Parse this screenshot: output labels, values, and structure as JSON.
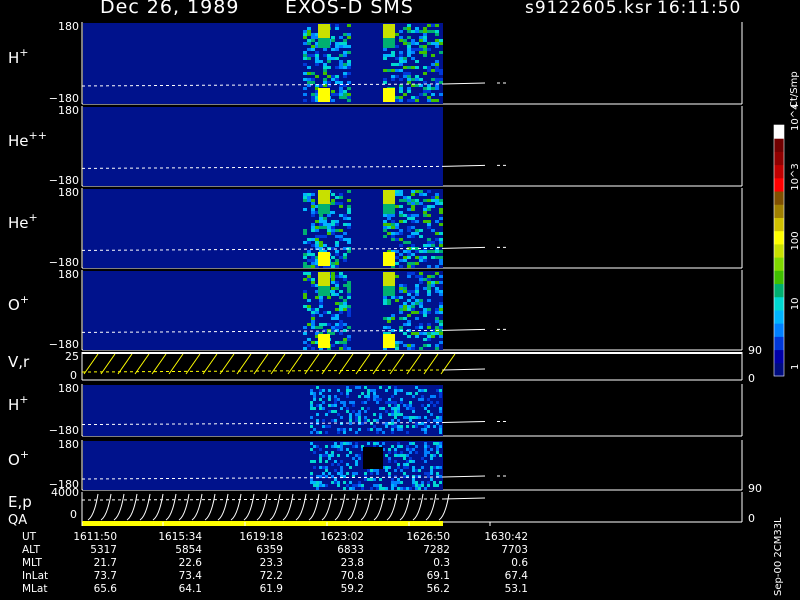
{
  "header": {
    "date": "Dec 26, 1989",
    "mission": "EXOS-D SMS",
    "file": "s9122605.ksr",
    "time": "16:11:50"
  },
  "colorbar": {
    "unit_label": "Ct/Smp",
    "ticks": [
      "1",
      "10",
      "100",
      "10^3",
      "10^4"
    ],
    "colors": [
      "#000c80",
      "#0000a8",
      "#0038d8",
      "#0080ff",
      "#00b4ff",
      "#00d8d0",
      "#00b070",
      "#40c000",
      "#80d800",
      "#c8e000",
      "#ffff00",
      "#d0c000",
      "#a08000",
      "#805000",
      "#ff0000",
      "#c00000",
      "#900000",
      "#700000",
      "#ffffff"
    ]
  },
  "vertical_label": "Sep-00  2CM33L",
  "panels": [
    {
      "label_base": "H",
      "label_sup": "+",
      "y_top_label": "180",
      "y_bottom_label": "−180",
      "kind": "spectrogram"
    },
    {
      "label_base": "He",
      "label_sup": "++",
      "y_top_label": "180",
      "y_bottom_label": "−180",
      "kind": "spectrogram"
    },
    {
      "label_base": "He",
      "label_sup": "+",
      "y_top_label": "180",
      "y_bottom_label": "−180",
      "kind": "spectrogram"
    },
    {
      "label_base": "O",
      "label_sup": "+",
      "y_top_label": "180",
      "y_bottom_label": "−180",
      "kind": "spectrogram"
    },
    {
      "label_base": "V,r",
      "label_sup": "",
      "y_top_label": "25",
      "y_bottom_label": "0",
      "right_top": "90",
      "right_bottom": "0",
      "kind": "voltage"
    },
    {
      "label_base": "H",
      "label_sup": "+",
      "y_top_label": "180",
      "y_bottom_label": "−180",
      "kind": "spectrogram"
    },
    {
      "label_base": "O",
      "label_sup": "+",
      "y_top_label": "180",
      "y_bottom_label": "−180",
      "kind": "spectrogram"
    },
    {
      "label_base": "E,p",
      "label_sup": "",
      "label2": "QA",
      "y_top_label": "4000",
      "y_bottom_label": "0",
      "right_top": "90",
      "right_bottom": "0",
      "kind": "energy"
    }
  ],
  "ephemeris": {
    "rows": [
      {
        "label": "UT",
        "values": [
          "1611:50",
          "1615:34",
          "1619:18",
          "1623:02",
          "1626:50",
          "1630:42"
        ]
      },
      {
        "label": "ALT",
        "values": [
          "5317",
          "5854",
          "6359",
          "6833",
          "7282",
          "7703"
        ]
      },
      {
        "label": "MLT",
        "values": [
          "21.7",
          "22.6",
          "23.3",
          "23.8",
          "0.3",
          "0.6"
        ]
      },
      {
        "label": "InLat",
        "values": [
          "73.7",
          "73.4",
          "72.2",
          "70.8",
          "69.1",
          "67.4"
        ]
      },
      {
        "label": "MLat",
        "values": [
          "65.6",
          "64.1",
          "61.9",
          "59.2",
          "56.2",
          "53.1"
        ]
      }
    ]
  },
  "chart_data": {
    "type": "heatmap",
    "title": "Dec 26, 1989   EXOS-D SMS",
    "x": [
      "1611:50",
      "1615:34",
      "1619:18",
      "1623:02",
      "1626:50",
      "1630:42"
    ],
    "color_scale": "log",
    "color_range": [
      1,
      10000
    ],
    "color_unit": "Ct/Smp",
    "y_range_pitch": [
      -180,
      180
    ],
    "series": [
      {
        "name": "H+",
        "type": "heatmap"
      },
      {
        "name": "He++",
        "type": "heatmap"
      },
      {
        "name": "He+",
        "type": "heatmap"
      },
      {
        "name": "O+",
        "type": "heatmap"
      },
      {
        "name": "V,r",
        "type": "line",
        "ylim": [
          0,
          25
        ]
      },
      {
        "name": "H+",
        "type": "heatmap"
      },
      {
        "name": "O+",
        "type": "heatmap"
      },
      {
        "name": "E,p",
        "type": "line",
        "ylim": [
          0,
          4000
        ]
      }
    ]
  }
}
